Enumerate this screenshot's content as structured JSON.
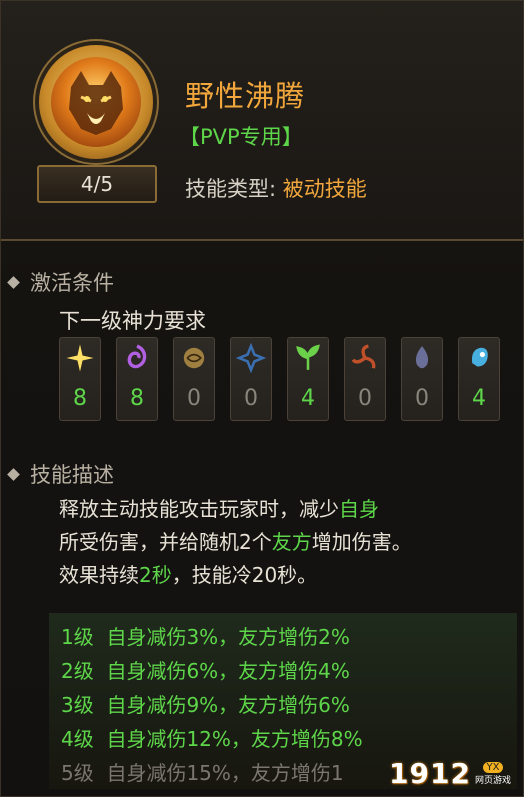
{
  "skill": {
    "name": "野性沸腾",
    "tag": "【PVP专用】",
    "level": "4/5",
    "type_label": "技能类型:",
    "type_value": "被动技能",
    "icon": "roaring-beast-icon"
  },
  "activation": {
    "heading": "激活条件",
    "requirement": "下一级神力要求",
    "slots": [
      {
        "icon": "star-burst-icon",
        "value": "8",
        "active": true,
        "color": "#ffe066"
      },
      {
        "icon": "purple-swirl-icon",
        "value": "8",
        "active": true,
        "color": "#b060e0"
      },
      {
        "icon": "golden-orb-icon",
        "value": "0",
        "active": false,
        "color": "#a08040"
      },
      {
        "icon": "blue-shuriken-icon",
        "value": "0",
        "active": false,
        "color": "#3a6fb0"
      },
      {
        "icon": "green-sprout-icon",
        "value": "4",
        "active": true,
        "color": "#6bd04a"
      },
      {
        "icon": "red-triskelion-icon",
        "value": "0",
        "active": false,
        "color": "#c0502a"
      },
      {
        "icon": "grey-flame-icon",
        "value": "0",
        "active": false,
        "color": "#6a6f9a"
      },
      {
        "icon": "blue-spirit-icon",
        "value": "4",
        "active": true,
        "color": "#48b0e0"
      }
    ]
  },
  "description": {
    "heading": "技能描述",
    "p1": "释放主动技能攻击玩家时，减少",
    "p1_hl": "自身",
    "p2": "所受伤害，并给随机2个",
    "p2_hl": "友方",
    "p2_end": "增加伤害。",
    "p3": "效果持续",
    "p3_hl": "2秒",
    "p3_end": "，技能冷20秒。"
  },
  "levels": [
    {
      "text": "1级  自身减伤3%，友方增伤2%",
      "active": true
    },
    {
      "text": "2级  自身减伤6%，友方增伤4%",
      "active": true
    },
    {
      "text": "3级  自身减伤9%，友方增伤6%",
      "active": true
    },
    {
      "text": "4级  自身减伤12%，友方增伤8%",
      "active": true
    },
    {
      "text": "5级  自身减伤15%，友方增伤1",
      "active": false
    }
  ],
  "watermark": {
    "number": "1912",
    "badge": "YX",
    "sub": "网页游戏"
  },
  "colors": {
    "accent_orange": "#f2a73c",
    "accent_green": "#5ed64a",
    "inactive": "#7a766e"
  }
}
